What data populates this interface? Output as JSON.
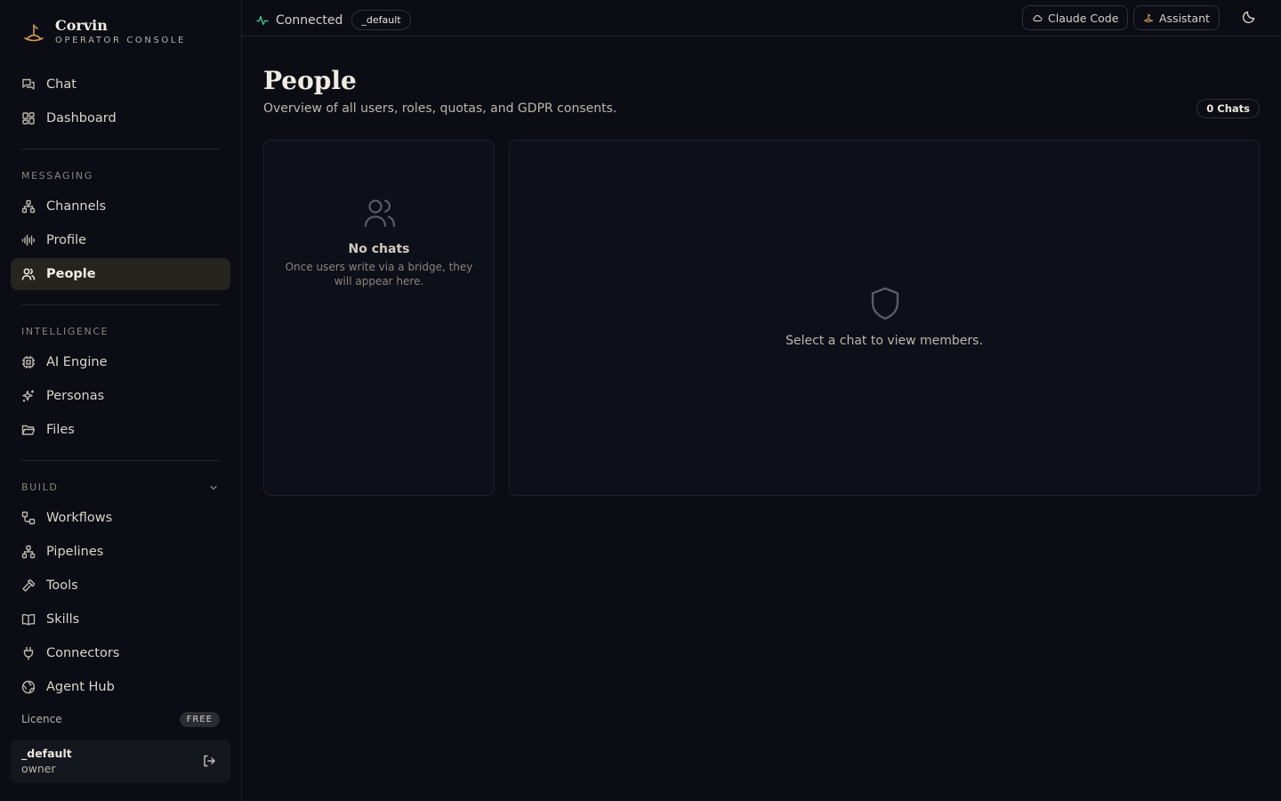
{
  "brand": {
    "name": "Corvin",
    "subtitle": "OPERATOR CONSOLE",
    "accent": "#d59a5b"
  },
  "sidebar": {
    "top_items": [
      {
        "label": "Chat",
        "icon": "chat-icon"
      },
      {
        "label": "Dashboard",
        "icon": "dashboard-icon"
      }
    ],
    "sections": [
      {
        "title": "MESSAGING",
        "items": [
          {
            "label": "Channels",
            "icon": "channels-icon"
          },
          {
            "label": "Profile",
            "icon": "audio-waveform-icon"
          },
          {
            "label": "People",
            "icon": "users-icon",
            "active": true
          }
        ]
      },
      {
        "title": "INTELLIGENCE",
        "items": [
          {
            "label": "AI Engine",
            "icon": "cpu-icon"
          },
          {
            "label": "Personas",
            "icon": "sparkles-icon"
          },
          {
            "label": "Files",
            "icon": "folder-icon"
          }
        ]
      },
      {
        "title": "BUILD",
        "collapsible": true,
        "items": [
          {
            "label": "Workflows",
            "icon": "workflow-icon"
          },
          {
            "label": "Pipelines",
            "icon": "pipelines-icon"
          },
          {
            "label": "Tools",
            "icon": "hammer-icon"
          },
          {
            "label": "Skills",
            "icon": "book-icon"
          },
          {
            "label": "Connectors",
            "icon": "plug-icon"
          },
          {
            "label": "Agent Hub",
            "icon": "globe-icon"
          }
        ]
      }
    ],
    "licence": {
      "label": "Licence",
      "badge": "FREE"
    },
    "user": {
      "name": "_default",
      "role": "owner"
    }
  },
  "topbar": {
    "status": "Connected",
    "status_color": "#3fbf8a",
    "tenant": "_default",
    "claude_code": "Claude Code",
    "assistant": "Assistant"
  },
  "main": {
    "title": "People",
    "subtitle": "Overview of all users, roles, quotas, and GDPR consents.",
    "chats_count": "0 Chats",
    "empty_title": "No chats",
    "empty_desc": "Once users write via a bridge, they will appear here.",
    "select_hint": "Select a chat to view members."
  }
}
